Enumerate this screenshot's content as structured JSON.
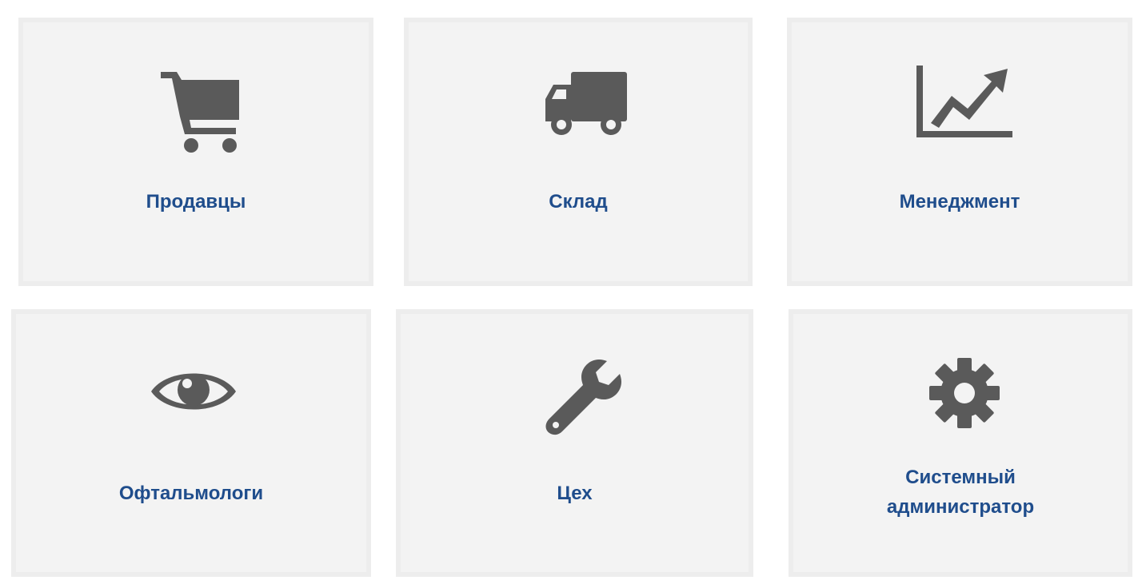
{
  "tiles": [
    {
      "label": "Продавцы",
      "icon": "shopping-cart-icon"
    },
    {
      "label": "Склад",
      "icon": "truck-icon"
    },
    {
      "label": "Менеджмент",
      "icon": "line-chart-icon"
    },
    {
      "label": "Офтальмологи",
      "icon": "eye-icon"
    },
    {
      "label": "Цех",
      "icon": "wrench-icon"
    },
    {
      "label_line1": "Системный",
      "label_line2": "администратор",
      "icon": "gear-icon"
    }
  ],
  "colors": {
    "tile_background": "#f3f3f3",
    "label": "#1f4d8c",
    "icon": "#5a5a5a"
  }
}
